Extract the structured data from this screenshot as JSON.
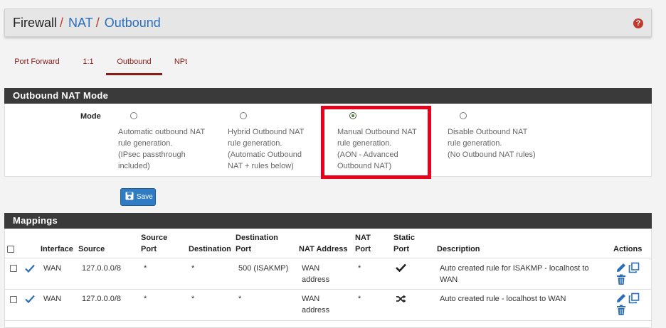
{
  "breadcrumb": {
    "first": "Firewall",
    "second": "NAT",
    "third": "Outbound",
    "sep": "/"
  },
  "help_icon": "?",
  "tabs": [
    "Port Forward",
    "1:1",
    "Outbound",
    "NPt"
  ],
  "active_tab": "Outbound",
  "mode_panel": {
    "title": "Outbound NAT Mode",
    "mode_label": "Mode",
    "options": [
      {
        "text": "Automatic outbound NAT\nrule generation.\n(IPsec passthrough\nincluded)",
        "checked": false
      },
      {
        "text": "Hybrid Outbound NAT\nrule generation.\n(Automatic Outbound\nNAT + rules below)",
        "checked": false
      },
      {
        "text": "Manual Outbound NAT\nrule generation.\n(AON - Advanced\nOutbound NAT)",
        "checked": true
      },
      {
        "text": "Disable Outbound NAT\nrule generation.\n(No Outbound NAT rules)",
        "checked": false
      }
    ]
  },
  "save_label": "Save",
  "mappings": {
    "title": "Mappings",
    "headers": {
      "interface": "Interface",
      "source": "Source",
      "source_port": "Source\nPort",
      "destination": "Destination",
      "destination_port": "Destination\nPort",
      "nat_address": "NAT Address",
      "nat_port": "NAT\nPort",
      "static_port": "Static\nPort",
      "description": "Description",
      "actions": "Actions"
    },
    "rows": [
      {
        "interface": "WAN",
        "source": "127.0.0.0/8",
        "source_port": "*",
        "destination": "*",
        "destination_port": "500 (ISAKMP)",
        "nat_address": "WAN\naddress",
        "nat_port": "*",
        "static_port_icon": "check-icon",
        "description": "Auto created rule for ISAKMP - localhost to\nWAN"
      },
      {
        "interface": "WAN",
        "source": "127.0.0.0/8",
        "source_port": "*",
        "destination": "*",
        "destination_port": "*",
        "nat_address": "WAN\naddress",
        "nat_port": "*",
        "static_port_icon": "shuffle-icon",
        "description": "Auto created rule - localhost to WAN"
      }
    ]
  }
}
